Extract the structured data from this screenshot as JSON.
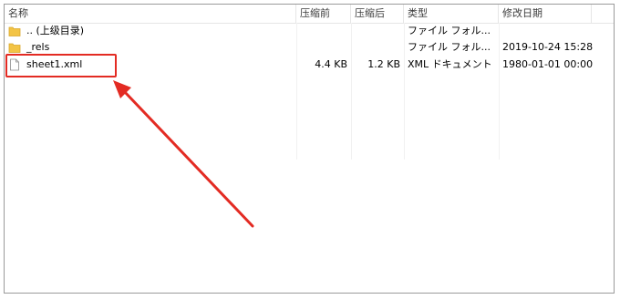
{
  "columns": {
    "name": "名称",
    "compressed": "压缩前",
    "uncompressed": "压缩后",
    "type": "类型",
    "modified": "修改日期"
  },
  "rows": [
    {
      "name": ".. (上级目录)",
      "compressed": "",
      "uncompressed": "",
      "type": "ファイル フォル...",
      "modified": "",
      "icon": "folder-icon"
    },
    {
      "name": "_rels",
      "compressed": "",
      "uncompressed": "",
      "type": "ファイル フォル...",
      "modified": "2019-10-24 15:28",
      "icon": "folder-icon"
    },
    {
      "name": "sheet1.xml",
      "compressed": "4.4 KB",
      "uncompressed": "1.2 KB",
      "type": "XML ドキュメント",
      "modified": "1980-01-01 00:00",
      "icon": "file-icon"
    }
  ],
  "annotation": {
    "color": "#e32b23"
  },
  "colors": {
    "folder": "#f3c445",
    "folder_dark": "#d9a72a"
  }
}
